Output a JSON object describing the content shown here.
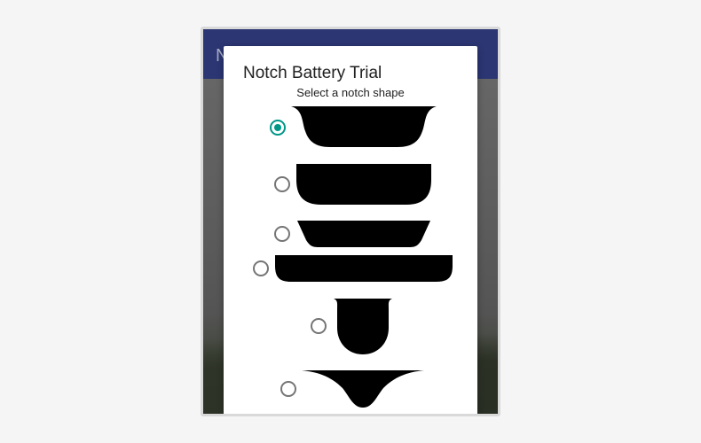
{
  "background_app": {
    "title_fragment": "N"
  },
  "dialog": {
    "title": "Notch Battery Trial",
    "subtitle": "Select a notch shape"
  },
  "notch_options": [
    {
      "name": "wide-curved-notch",
      "checked": true
    },
    {
      "name": "rounded-trapezoid-notch",
      "checked": false
    },
    {
      "name": "shallow-trapezoid-notch",
      "checked": false
    },
    {
      "name": "full-width-flat-notch",
      "checked": false
    },
    {
      "name": "narrow-u-notch",
      "checked": false
    },
    {
      "name": "waterdrop-notch",
      "checked": false
    }
  ],
  "colors": {
    "accent": "#009688",
    "app_bar": "#2c3673",
    "notch_fill": "#000000",
    "radio_unchecked": "#757575"
  }
}
